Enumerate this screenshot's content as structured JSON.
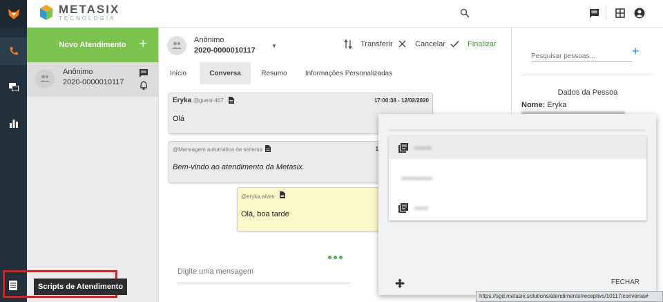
{
  "brand": {
    "name": "METASIX",
    "subtitle": "TECNOLOGIA"
  },
  "colors": {
    "accent_green": "#7bc24f",
    "rail": "#21303b",
    "highlight_red": "#e21b1b",
    "link_blue": "#2196f3"
  },
  "rail": {
    "items": [
      "fox-logo-icon",
      "phone-icon",
      "chat-icon",
      "bar-chart-icon",
      "script-list-icon"
    ]
  },
  "list": {
    "new_label": "Novo Atendimento",
    "contact": {
      "name": "Anônimo",
      "id": "2020-0000010117"
    }
  },
  "conversation": {
    "name": "Anônimo",
    "id": "2020-0000010117",
    "actions": {
      "transfer": "Transferir",
      "cancel": "Cancelar",
      "finish": "Finalizar"
    },
    "tabs": [
      "Início",
      "Conversa",
      "Resumo",
      "Informações Personalizadas"
    ],
    "active_tab": "Conversa",
    "messages": [
      {
        "author": "Eryka",
        "handle": "@guest-467",
        "time": "17:00:38 - 12/02/2020",
        "text": "Olá"
      },
      {
        "author": "",
        "handle": "@Mensagem automática de sistema",
        "time": "1",
        "text": "Bem-vindo ao atendimento da Metasix."
      },
      {
        "author": "",
        "handle": "@eryka.alves",
        "time": "",
        "text": "Olá, boa tarde"
      }
    ],
    "input_placeholder": "Digite uma mensagem"
  },
  "person": {
    "search_placeholder": "Pesquisar pessoas...",
    "section_title": "Dados da Pessoa",
    "name_label": "Nome:",
    "name_value": "Eryka"
  },
  "scripts": {
    "tooltip": "Scripts de Atendimento"
  },
  "modal": {
    "items": [
      {
        "label": "nnnnn",
        "icon": "library-books-icon"
      },
      {
        "label": "nnnnnnnnn",
        "icon": ""
      },
      {
        "label": "nnnn",
        "icon": "library-books-icon"
      }
    ],
    "close_label": "FECHAR"
  },
  "status_url": "https://sgd.metasix.solutions/atendimento/receptivo/10117/conversa#"
}
